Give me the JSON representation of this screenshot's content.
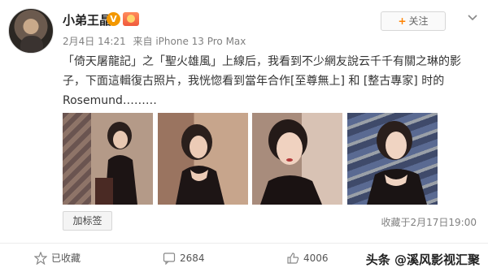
{
  "user": {
    "name": "小弟王晶"
  },
  "meta": {
    "date": "2月4日 14:21",
    "source": "来自 iPhone 13 Pro Max"
  },
  "follow": {
    "label": "关注",
    "plus": "+"
  },
  "post": {
    "text": "「倚天屠龍記」之「聖火雄風」上線后，我看到不少網友說云千千有關之琳的影子，下面這輯復古照片，我恍惚看到當年合作[至尊無上] 和 [整古專家] 时的Rosemund………"
  },
  "tags": {
    "label": "加标签"
  },
  "collected": "收藏于2月17日19:00",
  "actions": {
    "repost": "已收藏",
    "comments": "2684",
    "likes": "4006"
  },
  "watermark": "头条 @溪风影视汇聚",
  "colors": {
    "accent": "#ff8200",
    "verified": "#f39800"
  }
}
